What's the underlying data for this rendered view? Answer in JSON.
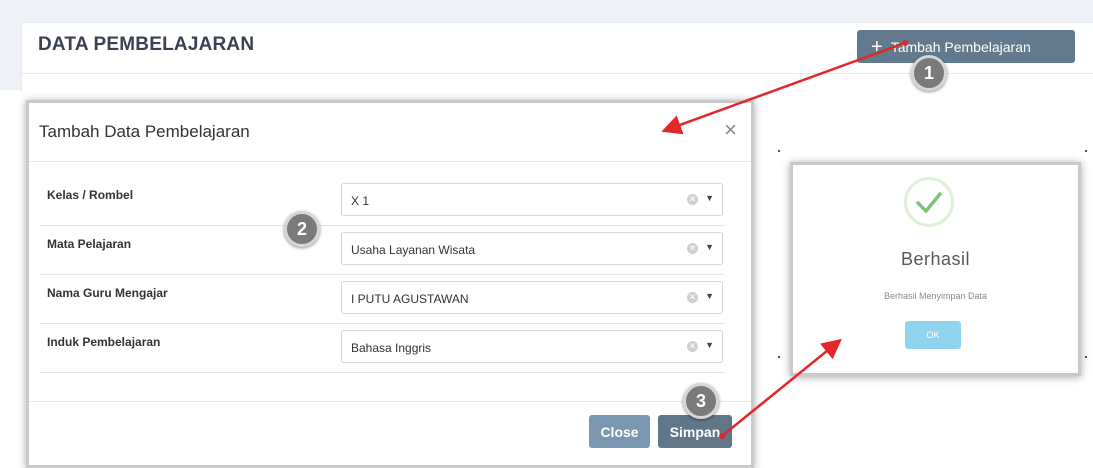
{
  "page": {
    "title": "DATA PEMBELAJARAN",
    "add_button_label": "Tambah Pembelajaran"
  },
  "steps": [
    "1",
    "2",
    "3"
  ],
  "modal": {
    "title": "Tambah Data Pembelajaran",
    "close_symbol": "×",
    "fields": [
      {
        "label": "Kelas / Rombel",
        "value": "X 1"
      },
      {
        "label": "Mata Pelajaran",
        "value": "Usaha Layanan Wisata"
      },
      {
        "label": "Nama Guru Mengajar",
        "value": "I PUTU AGUSTAWAN"
      },
      {
        "label": "Induk Pembelajaran",
        "value": "Bahasa Inggris"
      }
    ],
    "close_button_label": "Close",
    "save_button_label": "Simpan"
  },
  "success_dialog": {
    "title": "Berhasil",
    "message": "Berhasil Menyimpan Data",
    "ok_label": "OK"
  },
  "colors": {
    "primary_button": "#627a8d",
    "close_button": "#7a98b1",
    "ok_button": "#8fd3f0",
    "success_check": "#7cc47a",
    "annotation_arrow": "#e3262a"
  },
  "icons": {
    "plus": "plus-icon",
    "close": "close-icon",
    "clear": "clear-circle-icon",
    "dropdown": "chevron-down-icon",
    "success": "check-icon"
  }
}
